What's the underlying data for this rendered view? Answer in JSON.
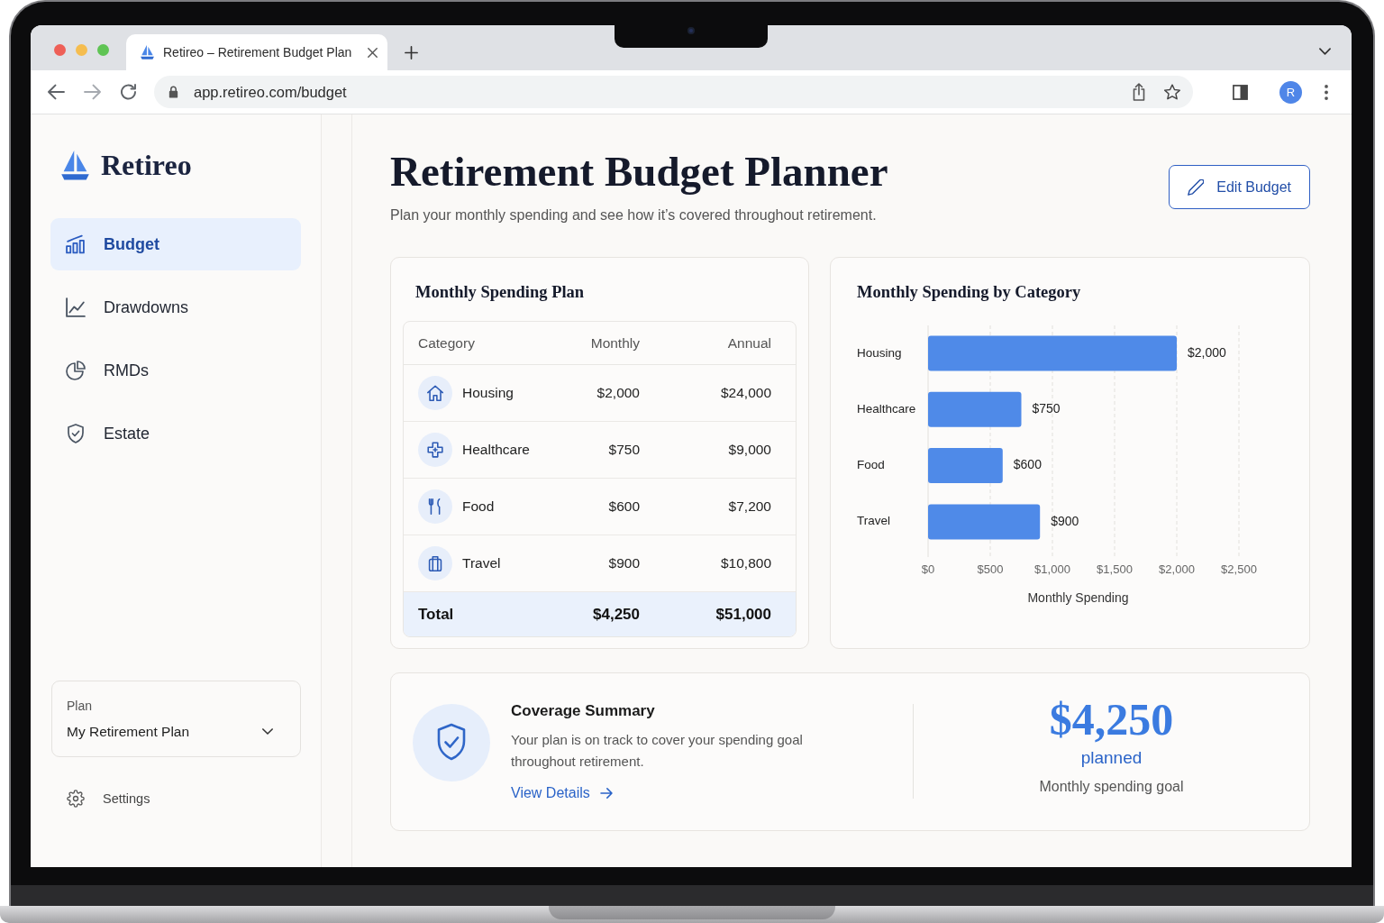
{
  "browser": {
    "tab": {
      "title": "Retireo – Retirement Budget Plan"
    },
    "nav_buttons": [
      {
        "kind": "back",
        "disabled": false
      },
      {
        "kind": "forward",
        "disabled": true
      },
      {
        "kind": "reload",
        "disabled": false
      }
    ],
    "address": "app.retireo.com/budget",
    "profile_initial": "R"
  },
  "sidebar": {
    "logo": "Retireo",
    "items": [
      {
        "label": "Budget",
        "selected": true
      },
      {
        "label": "Drawdowns",
        "selected": false
      },
      {
        "label": "RMDs",
        "selected": false
      },
      {
        "label": "Estate",
        "selected": false
      }
    ],
    "plan_select": {
      "label": "Plan",
      "value": "My Retirement Plan"
    },
    "settings": "Settings"
  },
  "header": {
    "title": "Retirement Budget Planner",
    "subtitle": "Plan your monthly spending and see how it’s covered throughout retirement.",
    "edit_button": "Edit Budget"
  },
  "spending_plan": {
    "title": "Monthly Spending Plan",
    "columns": [
      "Category",
      "Monthly",
      "Annual"
    ],
    "rows": [
      {
        "category": "Housing",
        "monthly": "$2,000",
        "annual": "$24,000"
      },
      {
        "category": "Healthcare",
        "monthly": "$750",
        "annual": "$9,000"
      },
      {
        "category": "Food",
        "monthly": "$600",
        "annual": "$7,200"
      },
      {
        "category": "Travel",
        "monthly": "$900",
        "annual": "$10,800"
      }
    ],
    "total": {
      "label": "Total",
      "monthly": "$4,250",
      "annual": "$51,000"
    }
  },
  "category_chart": {
    "chart_data": [
      {
        "type": "bar",
        "orientation": "horizontal",
        "title": "Monthly Spending by Category",
        "categories": [
          "Housing",
          "Healthcare",
          "Food",
          "Travel"
        ],
        "values": [
          2000,
          750,
          600,
          900
        ],
        "color": "#4f8ae8",
        "value_labels": [
          "$2,000",
          "$750",
          "$600",
          "$900"
        ],
        "xlabel": "Monthly Spending",
        "xlim": [
          0,
          2500
        ],
        "xticks": [
          {
            "value": 0,
            "label": "$0"
          },
          {
            "value": 500,
            "label": "$500"
          },
          {
            "value": 1000,
            "label": "$1,000"
          },
          {
            "value": 1500,
            "label": "$1,500"
          },
          {
            "value": 2000,
            "label": "$2,000"
          },
          {
            "value": 2500,
            "label": "$2,500"
          }
        ],
        "grid": true
      }
    ]
  },
  "coverage": {
    "title": "Coverage Summary",
    "text": "Your plan is on track to cover your spending goal throughout retirement.",
    "link": "View Details",
    "amount": "$4,250",
    "amount_caption": "planned",
    "goal_label": "Monthly spending goal"
  }
}
